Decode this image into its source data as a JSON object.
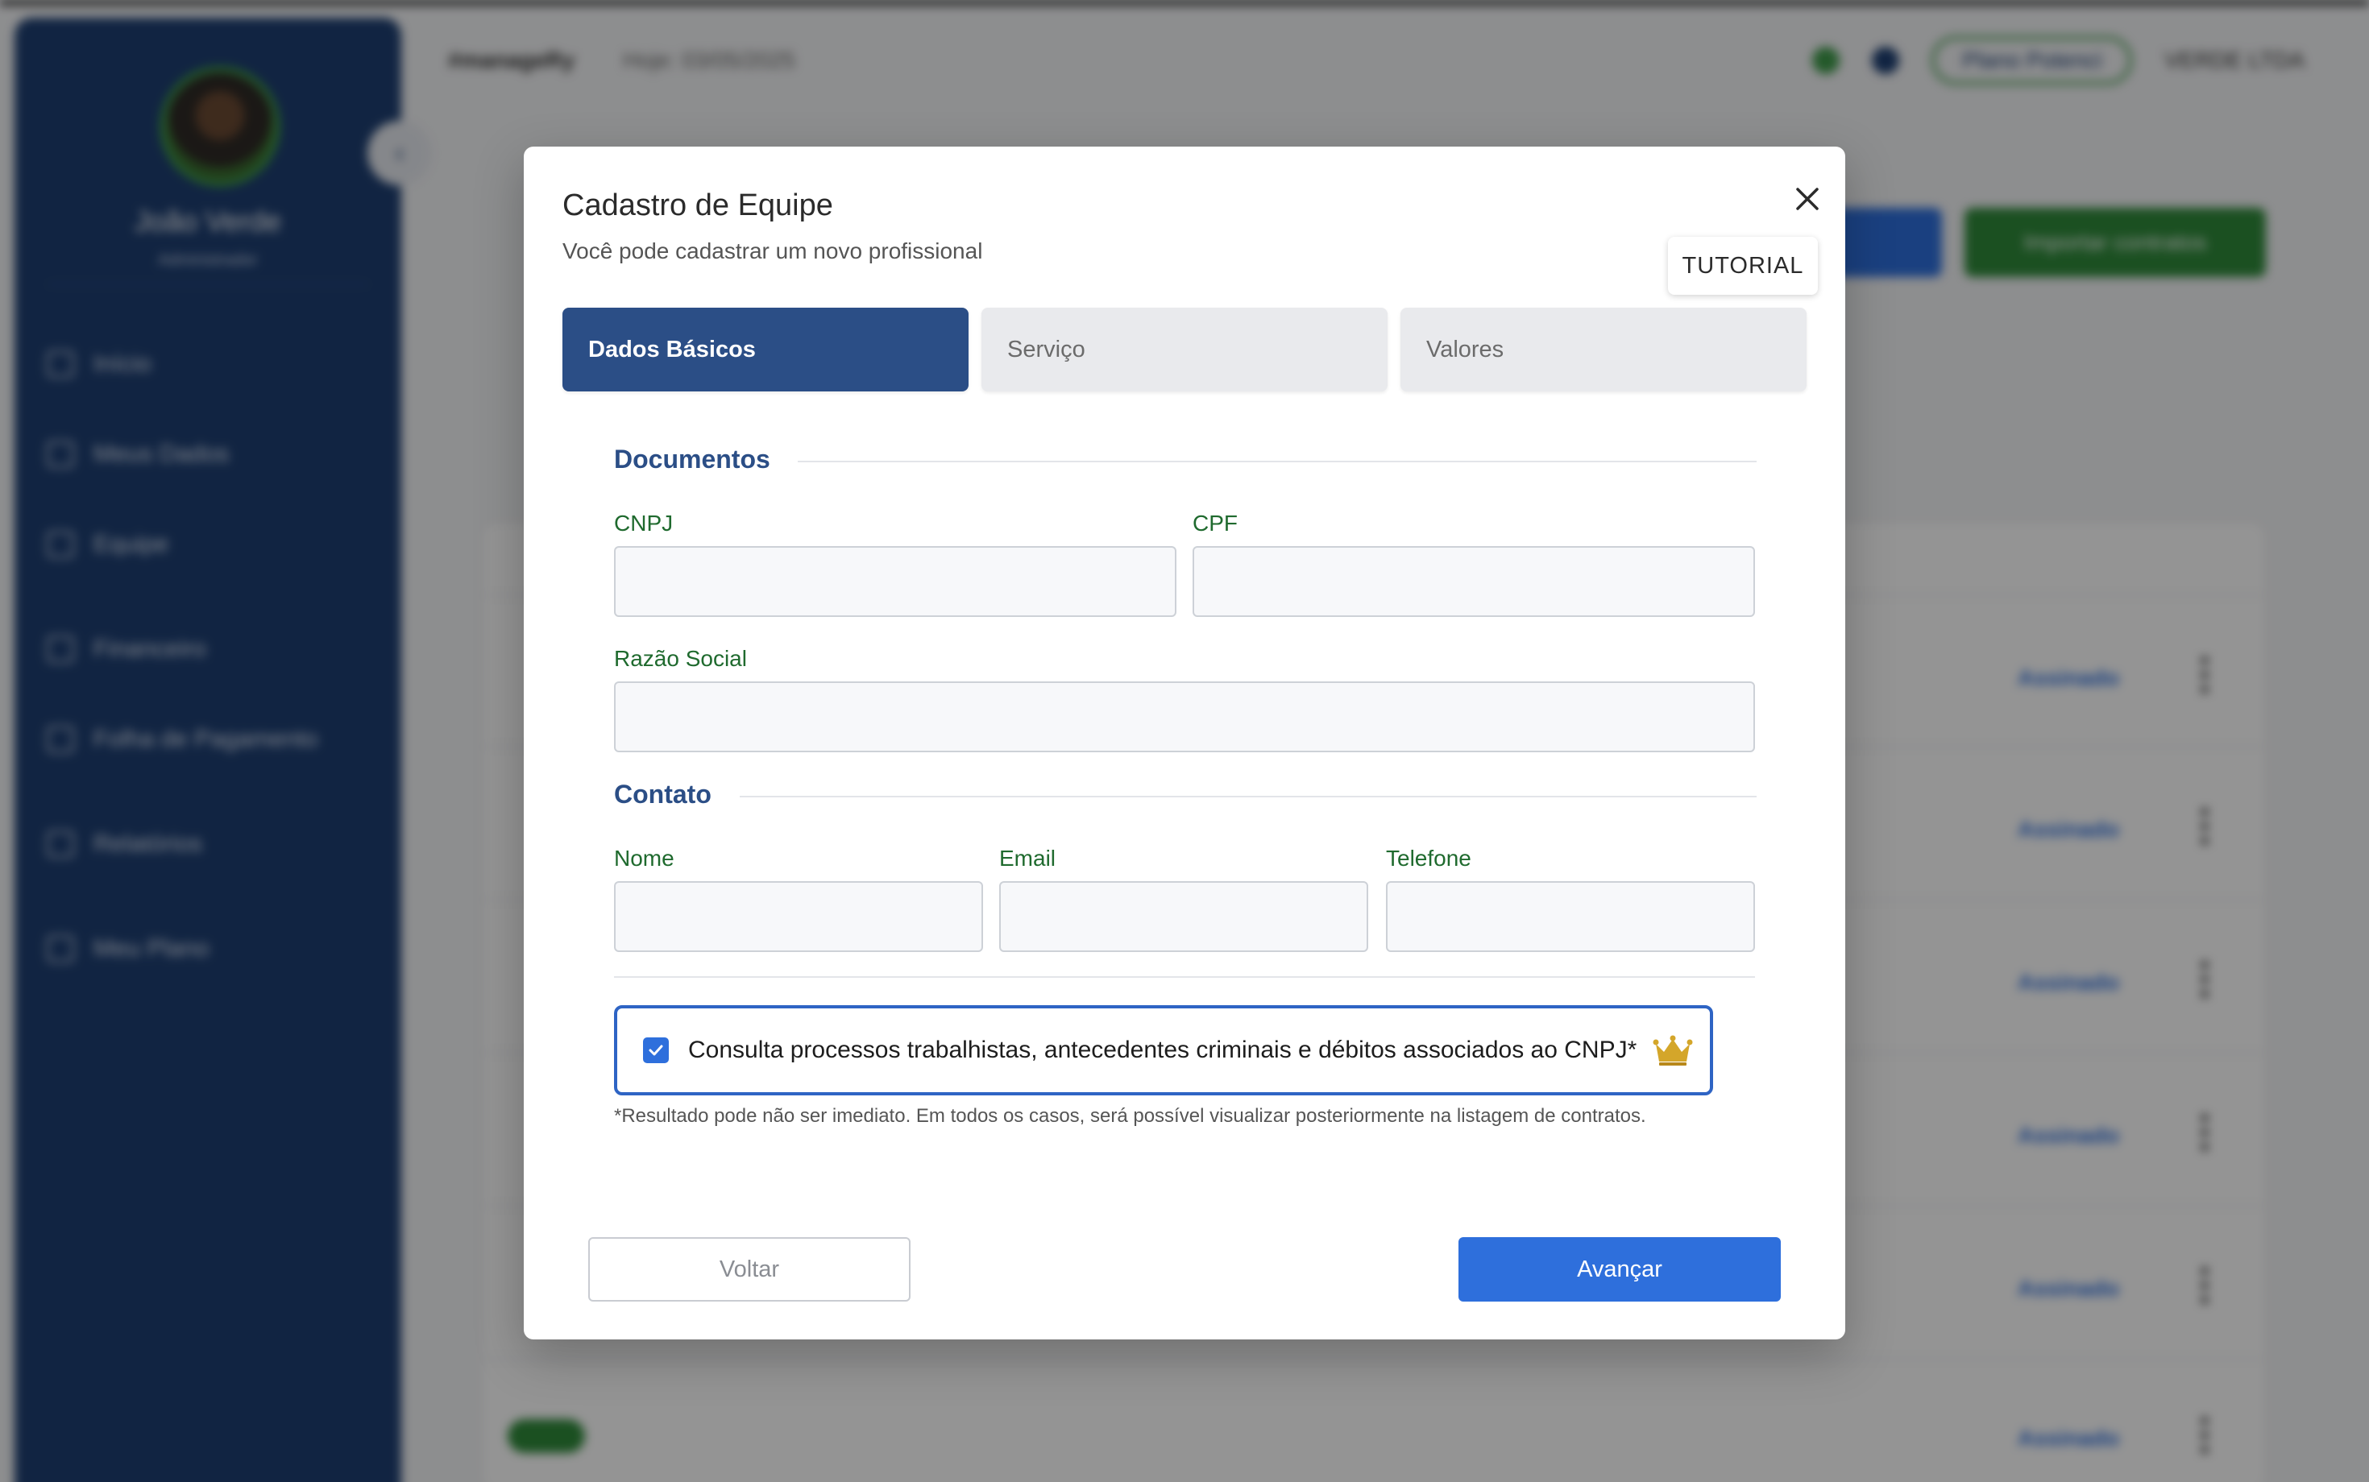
{
  "background": {
    "sidebar": {
      "user_name": "João Verde",
      "user_role": "Administrador",
      "items": [
        {
          "label": "Início",
          "icon": "home-icon"
        },
        {
          "label": "Meus Dados",
          "icon": "user-icon"
        },
        {
          "label": "Equipe",
          "icon": "team-icon"
        },
        {
          "label": "Financeiro",
          "icon": "finance-icon"
        },
        {
          "label": "Folha de Pagamento",
          "icon": "payroll-icon"
        },
        {
          "label": "Relatórios",
          "icon": "reports-icon"
        },
        {
          "label": "Meu Plano",
          "icon": "star-icon"
        }
      ]
    },
    "topbar": {
      "brand": "#manageRy",
      "date": "Hoje: 03/05/2025",
      "plan_badge": "Plano Potenci",
      "company": "VERDE LTDA"
    },
    "actions": {
      "import_label": "Importar contratos"
    },
    "table_links": [
      "Assinado",
      "Assinado",
      "Assinado",
      "Assinado",
      "Assinado",
      "Assinado"
    ]
  },
  "modal": {
    "title": "Cadastro de Equipe",
    "subtitle": "Você pode cadastrar um novo profissional",
    "tutorial_label": "TUTORIAL",
    "tabs": [
      {
        "label": "Dados Básicos",
        "active": true
      },
      {
        "label": "Serviço",
        "active": false
      },
      {
        "label": "Valores",
        "active": false
      }
    ],
    "sections": {
      "documentos": {
        "title": "Documentos",
        "cnpj_label": "CNPJ",
        "cnpj_value": "",
        "cpf_label": "CPF",
        "cpf_value": "",
        "razao_label": "Razão Social",
        "razao_value": ""
      },
      "contato": {
        "title": "Contato",
        "nome_label": "Nome",
        "nome_value": "",
        "email_label": "Email",
        "email_value": "",
        "telefone_label": "Telefone",
        "telefone_value": ""
      }
    },
    "consent": {
      "checked": true,
      "text": "Consulta processos trabalhistas, antecedentes criminais e débitos associados ao CNPJ*",
      "icon": "crown-icon"
    },
    "footnote": "*Resultado pode não ser imediato. Em todos os casos, será possível visualizar posteriormente na listagem de contratos.",
    "buttons": {
      "back": "Voltar",
      "next": "Avançar"
    }
  },
  "colors": {
    "primary": "#2e6fdc",
    "tab_active": "#2b4e86",
    "label_green": "#1f6a2e",
    "sidebar": "#1e3f72",
    "crown": "#d4a62a"
  }
}
